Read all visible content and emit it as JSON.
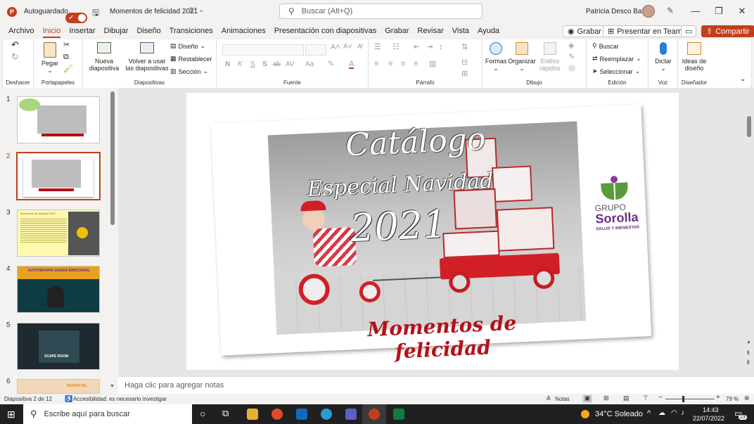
{
  "titlebar": {
    "autosave_label": "Autoguardado",
    "doc_title": "Momentos de felicidad 2021",
    "search_placeholder": "Buscar (Alt+Q)",
    "user_name": "Patricia Desco Baño"
  },
  "menu": {
    "tabs": [
      "Archivo",
      "Inicio",
      "Insertar",
      "Dibujar",
      "Diseño",
      "Transiciones",
      "Animaciones",
      "Presentación con diapositivas",
      "Grabar",
      "Revisar",
      "Vista",
      "Ayuda"
    ],
    "active": "Inicio",
    "record_label": "Grabar",
    "present_teams_label": "Presentar en Teams",
    "share_label": "Compartir"
  },
  "ribbon": {
    "undo_group": "Deshacer",
    "clipboard": {
      "paste": "Pegar",
      "group": "Portapapeles"
    },
    "slides": {
      "new_slide": "Nueva diapositiva",
      "reuse": "Volver a usar las diapositivas",
      "layout": "Diseño",
      "reset": "Restablecer",
      "section": "Sección",
      "group": "Diapositivas"
    },
    "font": {
      "group": "Fuente",
      "bold": "N",
      "italic": "K",
      "underline": "S",
      "strike": "S",
      "abc": "ab",
      "spacing": "AV",
      "case": "Aa"
    },
    "paragraph": {
      "group": "Párrafo"
    },
    "drawing": {
      "shapes": "Formas",
      "arrange": "Organizar",
      "quick_styles": "Estilos rápidos",
      "group": "Dibujo"
    },
    "editing": {
      "find": "Buscar",
      "replace": "Reemplazar",
      "select": "Seleccionar",
      "group": "Edición"
    },
    "voice": {
      "dictate": "Dictar",
      "group": "Voz"
    },
    "designer": {
      "ideas": "Ideas de diseño",
      "group": "Diseñador"
    }
  },
  "thumbnails": [
    {
      "num": "1"
    },
    {
      "num": "2"
    },
    {
      "num": "3",
      "title": "Momentos de felicidad 2021"
    },
    {
      "num": "4",
      "title": "AUTOTERAPIA GUIADA EMOCIONAL"
    },
    {
      "num": "5",
      "title": "SCAPE ROOM"
    },
    {
      "num": "6",
      "title": "SESIÓN DE..."
    }
  ],
  "slide": {
    "catalog": "Catálogo",
    "special": "Especial Navidad",
    "year": "2021",
    "tagline": "Momentos de felicidad",
    "logo_top": "GRUPO",
    "logo_brand": "Sorolla",
    "logo_sub": "SALUD Y BIENESTAR"
  },
  "notes_placeholder": "Haga clic para agregar notas",
  "status": {
    "slide_info": "Diapositiva 2 de 12",
    "accessibility": "Accesibilidad: es necesario investigar",
    "notes": "Notas",
    "zoom": "79 %"
  },
  "taskbar": {
    "search": "Escribe aquí para buscar",
    "weather": "34°C Soleado",
    "time": "14:43",
    "date": "22/07/2022",
    "notif_count": "23"
  },
  "colors": {
    "accent": "#c43e1c",
    "brand_purple": "#6b2d86",
    "brand_green": "#5a9a3c"
  }
}
